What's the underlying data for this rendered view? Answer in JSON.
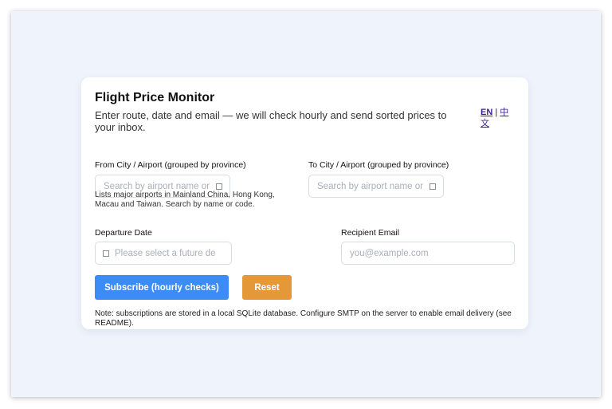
{
  "header": {
    "title": "Flight Price Monitor",
    "subtitle": "Enter route, date and email — we will check hourly and send sorted prices to your inbox."
  },
  "language": {
    "en_label": "EN",
    "separator": "|",
    "zh_label": "中文"
  },
  "form": {
    "from": {
      "label": "From City / Airport (grouped by province)",
      "placeholder": "Search by airport name or I"
    },
    "to": {
      "label": "To City / Airport (grouped by province)",
      "placeholder": "Search by airport name or I"
    },
    "hint": "Lists major airports in Mainland China, Hong Kong, Macau and Taiwan. Search by name or code.",
    "date": {
      "label": "Departure Date",
      "placeholder": "Please select a future de"
    },
    "email": {
      "label": "Recipient Email",
      "placeholder": "you@example.com"
    }
  },
  "actions": {
    "subscribe_label": "Subscribe (hourly checks)",
    "reset_label": "Reset"
  },
  "note": "Note: subscriptions are stored in a local SQLite database. Configure SMTP on the server to enable email delivery (see README).",
  "colors": {
    "primary": "#3b8cf7",
    "reset": "#e59837",
    "background": "#eff3fc",
    "link": "#3a1f8f"
  }
}
